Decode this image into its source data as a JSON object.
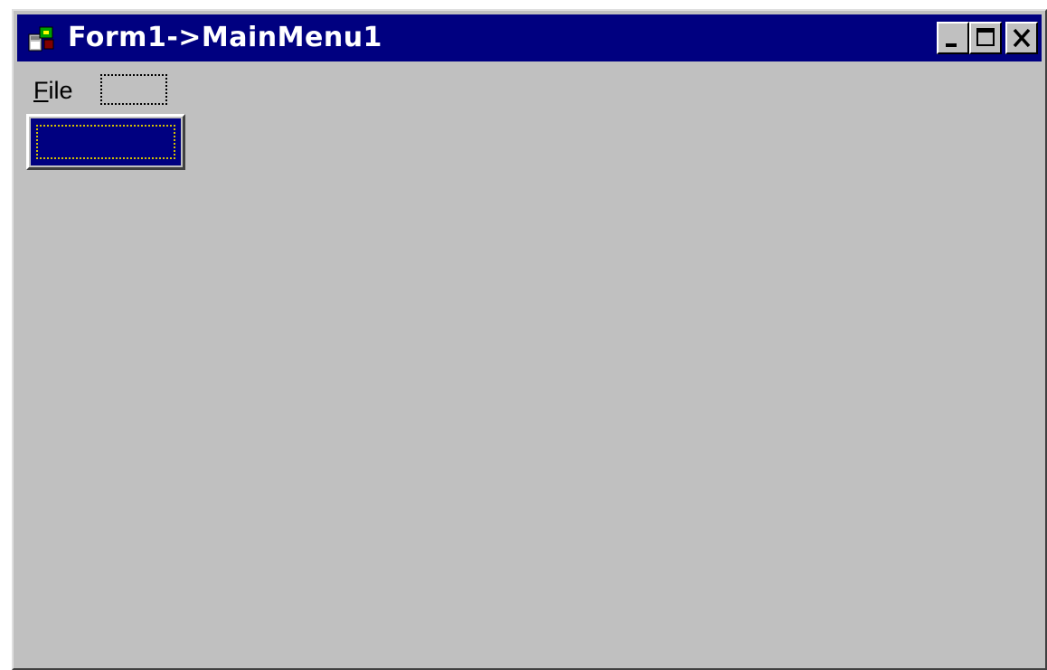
{
  "window": {
    "title": "Form1->MainMenu1",
    "icon": "form-designer-icon",
    "controls": {
      "minimize_icon": "minimize-icon",
      "maximize_icon": "maximize-icon",
      "close_icon": "close-icon"
    }
  },
  "menubar": {
    "items": [
      {
        "label_mnemonic": "F",
        "label_rest": "ile",
        "label": "File"
      }
    ],
    "placeholder": ""
  },
  "submenu": {
    "selected_item_label": ""
  },
  "colors": {
    "titlebar": "#000080",
    "face": "#c0c0c0",
    "focus_dots": "#d4c000"
  }
}
